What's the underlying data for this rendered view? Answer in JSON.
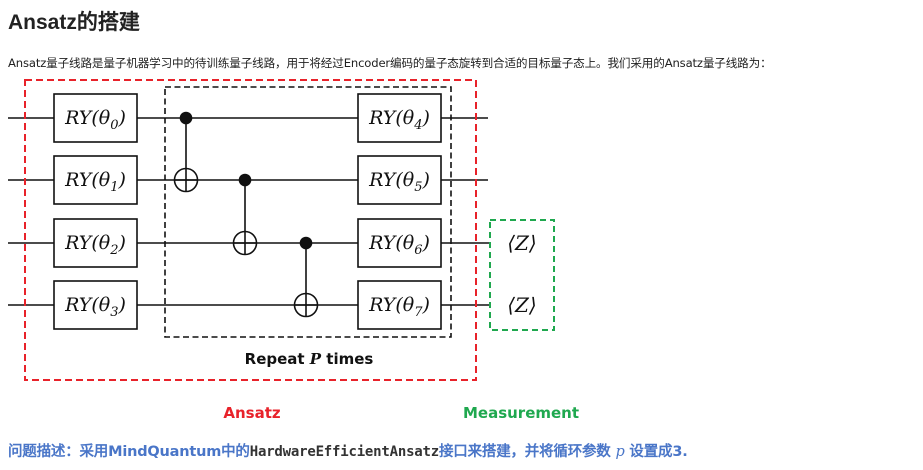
{
  "heading": "Ansatz的搭建",
  "intro": "Ansatz量子线路是量子机器学习中的待训练量子线路，用于将经过Encoder编码的量子态旋转到合适的目标量子态上。我们采用的Ansatz量子线路为：",
  "circuit": {
    "ry_gates_left": [
      "RY(θ0)",
      "RY(θ1)",
      "RY(θ2)",
      "RY(θ3)"
    ],
    "ry_gates_right": [
      "RY(θ4)",
      "RY(θ5)",
      "RY(θ6)",
      "RY(θ7)"
    ],
    "ry_prefix": "RY(θ",
    "ry_suffix": ")",
    "ry_subscripts_left": [
      "0",
      "1",
      "2",
      "3"
    ],
    "ry_subscripts_right": [
      "4",
      "5",
      "6",
      "7"
    ],
    "repeat_label_pre": "Repeat ",
    "repeat_label_var": "P",
    "repeat_label_post": " times",
    "measurement_symbol": "⟨Z⟩",
    "ansatz_label": "Ansatz",
    "measurement_label": "Measurement",
    "colors": {
      "ansatz_box": "#e8222a",
      "measurement_box": "#1fa84f",
      "repeat_box": "#111111",
      "ansatz_label": "#e8222a",
      "measurement_label": "#1fa84f"
    }
  },
  "question": {
    "prefix": "问题描述：采用MindQuantum中的",
    "code": "HardwareEfficientAnsatz",
    "middle": "接口来搭建，并将循环参数",
    "var": "p",
    "suffix": "设置成3."
  }
}
